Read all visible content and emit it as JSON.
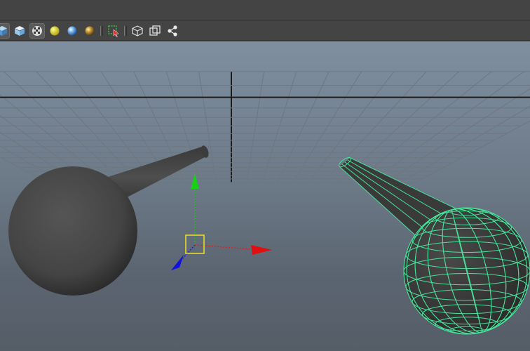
{
  "toolbar": {
    "tools": [
      {
        "name": "cube-blue-icon",
        "kind": "cube-blue",
        "active": true
      },
      {
        "name": "cube-white-icon",
        "kind": "cube-white",
        "active": false
      },
      {
        "name": "checker-texture-icon",
        "kind": "checker",
        "active": true
      },
      {
        "name": "yellow-light-sphere-icon",
        "kind": "sphere-yellow",
        "active": false
      },
      {
        "name": "blue-sphere-icon",
        "kind": "sphere-blue",
        "active": false
      },
      {
        "name": "gold-sphere-icon",
        "kind": "sphere-gold",
        "active": false
      },
      {
        "name": "separator",
        "kind": "sep"
      },
      {
        "name": "select-region-icon",
        "kind": "select-region",
        "active": false
      },
      {
        "name": "separator",
        "kind": "sep"
      },
      {
        "name": "wireframe-cube-icon",
        "kind": "cube-wire",
        "active": false
      },
      {
        "name": "overlap-squares-icon",
        "kind": "overlap",
        "active": false
      },
      {
        "name": "share-nodes-icon",
        "kind": "share",
        "active": false
      }
    ]
  },
  "colors": {
    "toolbar_bg": "#444444",
    "viewport_top": "#7f8fa0",
    "viewport_bottom": "#555d67",
    "grid_line": "#6e7680",
    "grid_axis": "#1b1b1b",
    "object_gray": "#4a4a4a",
    "wireframe_green": "#46e29a",
    "axis_x": "#e01010",
    "axis_y": "#10c010",
    "axis_z": "#1010e0",
    "pivot_yellow": "#f0e020"
  }
}
